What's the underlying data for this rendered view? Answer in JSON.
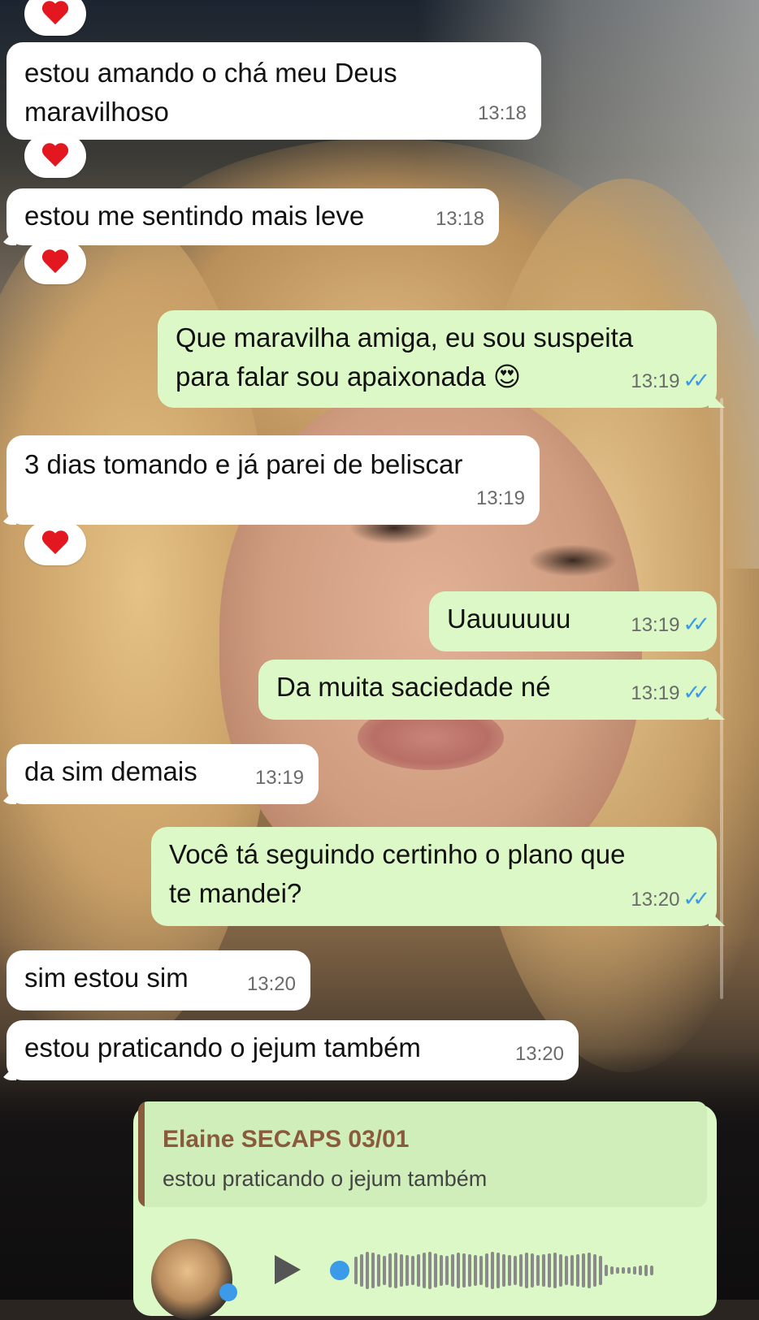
{
  "colors": {
    "incoming_bubble": "#ffffff",
    "outgoing_bubble": "#dbf8c6",
    "read_ticks": "#3b9be8",
    "reaction_heart": "#e2171f",
    "quote_accent": "#8a5a3c"
  },
  "messages": [
    {
      "direction": "in",
      "text_lines": [
        "estou amando o chá meu Deus",
        "maravilhoso"
      ],
      "time": "13:18",
      "reaction": "heart-icon"
    },
    {
      "direction": "in",
      "text_lines": [
        "estou me sentindo mais leve"
      ],
      "time": "13:18",
      "reaction": "heart-icon"
    },
    {
      "direction": "out",
      "text_lines": [
        "Que maravilha amiga, eu sou suspeita",
        "para falar sou apaixonada 😍"
      ],
      "time": "13:19",
      "status": "read"
    },
    {
      "direction": "in",
      "text_lines": [
        "3 dias tomando e já parei de beliscar"
      ],
      "time": "13:19",
      "reaction": "heart-icon"
    },
    {
      "direction": "out",
      "text_lines": [
        "Uauuuuuu"
      ],
      "time": "13:19",
      "status": "read"
    },
    {
      "direction": "out",
      "text_lines": [
        "Da muita saciedade né"
      ],
      "time": "13:19",
      "status": "read"
    },
    {
      "direction": "in",
      "text_lines": [
        "da sim demais"
      ],
      "time": "13:19"
    },
    {
      "direction": "out",
      "text_lines": [
        "Você tá seguindo certinho o plano que",
        "te mandei?"
      ],
      "time": "13:20",
      "status": "read"
    },
    {
      "direction": "in",
      "text_lines": [
        "sim estou sim"
      ],
      "time": "13:20"
    },
    {
      "direction": "in",
      "text_lines": [
        "estou praticando o jejum também"
      ],
      "time": "13:20"
    }
  ],
  "reply_message": {
    "quoted_author": "Elaine SECAPS 03/01",
    "quoted_text": "estou praticando o jejum também",
    "attachment": "voice-note",
    "icons": [
      "avatar",
      "play-icon",
      "mic-icon"
    ]
  }
}
